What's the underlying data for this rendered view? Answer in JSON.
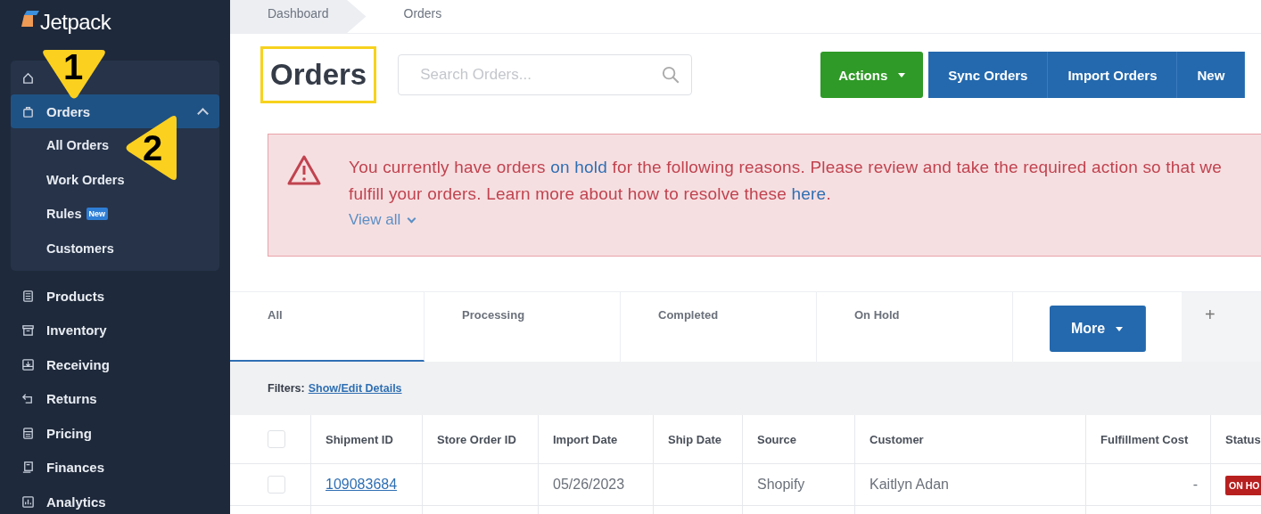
{
  "sidebar": {
    "logo": "Jetpack",
    "sections": [
      {
        "kind": "panel",
        "items": [
          {
            "selected": false
          },
          {
            "label": "Orders",
            "selected": true,
            "expanded": true,
            "children": [
              {
                "label": "All Orders"
              },
              {
                "label": "Work Orders"
              },
              {
                "label": "Rules",
                "badge": "New"
              },
              {
                "label": "Customers"
              }
            ]
          }
        ]
      },
      {
        "kind": "plain",
        "items": [
          {
            "label": "Products",
            "selected": false
          },
          {
            "label": "Inventory",
            "selected": false
          },
          {
            "label": "Receiving",
            "selected": false
          },
          {
            "label": "Returns",
            "selected": false
          },
          {
            "label": "Pricing",
            "selected": false
          },
          {
            "label": "Finances",
            "selected": false
          },
          {
            "label": "Analytics",
            "selected": false
          }
        ]
      }
    ]
  },
  "callouts": [
    {
      "number": "1",
      "kind": "down"
    },
    {
      "number": "2",
      "kind": "left"
    }
  ],
  "breadcrumb": [
    "Dashboard",
    "Orders"
  ],
  "title": {
    "text": "Orders",
    "highlighted": true
  },
  "search": {
    "placeholder": "Search Orders..."
  },
  "buttons": [
    {
      "label": "Actions",
      "kind": "dropdown-green"
    },
    {
      "label": "Sync Orders",
      "kind": "blue"
    },
    {
      "label": "Import Orders",
      "kind": "blue"
    },
    {
      "label": "New",
      "kind": "blue"
    }
  ],
  "alert": {
    "lines": [
      [
        {
          "kind": "text",
          "text": "You currently have orders "
        },
        {
          "kind": "link",
          "text": "on hold"
        },
        {
          "kind": "text",
          "text": " for the following reasons. Please review and take the required action so that we"
        }
      ],
      [
        {
          "kind": "text",
          "text": "fulfill your orders. Learn more about how to resolve these "
        },
        {
          "kind": "link",
          "text": "here"
        },
        {
          "kind": "text",
          "text": "."
        }
      ]
    ],
    "toggle": "View all"
  },
  "tabs": [
    {
      "label": "All",
      "selected": true
    },
    {
      "label": "Processing",
      "selected": false
    },
    {
      "label": "Completed",
      "selected": false
    },
    {
      "label": "On Hold",
      "selected": false
    }
  ],
  "more_button": "More",
  "add_tab": "+",
  "filters": {
    "label": "Filters:",
    "link": "Show/Edit Details"
  },
  "table": {
    "select_all": {
      "checked": false
    },
    "columns": [
      "Shipment ID",
      "Store Order ID",
      "Import Date",
      "Ship Date",
      "Source",
      "Customer",
      "Fulfillment Cost",
      "Status"
    ],
    "rows": [
      {
        "checked": false,
        "cells": [
          "109083684",
          "",
          "05/26/2023",
          "",
          "Shopify",
          "Kaitlyn Adan",
          "-",
          "ON HO"
        ]
      }
    ]
  }
}
